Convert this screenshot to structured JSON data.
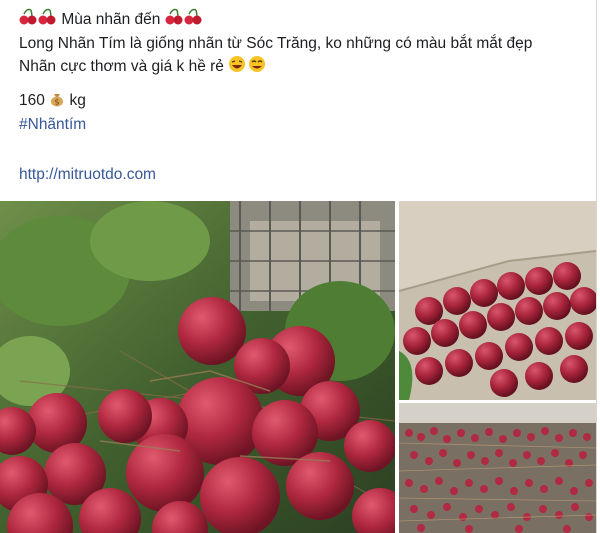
{
  "post": {
    "title_text": "Mùa nhãn đến",
    "line2": "Long Nhãn Tím là giống nhãn từ Sóc Trăng, ko những có màu bắt mắt đẹp",
    "line3": "Nhãn cực thơm và giá k hề rẻ",
    "price_value": "160",
    "price_unit": "kg",
    "hashtag": "#Nhãntím",
    "link": "http://mitruotdo.com"
  },
  "icons": {
    "title_left": "cherry-icon",
    "title_right": "cherry-icon",
    "line3": "laughing-face-icon",
    "price": "money-bag-icon"
  },
  "colors": {
    "link": "#385898",
    "fruit": "#b0283f",
    "foliage": "#4a6a35"
  }
}
